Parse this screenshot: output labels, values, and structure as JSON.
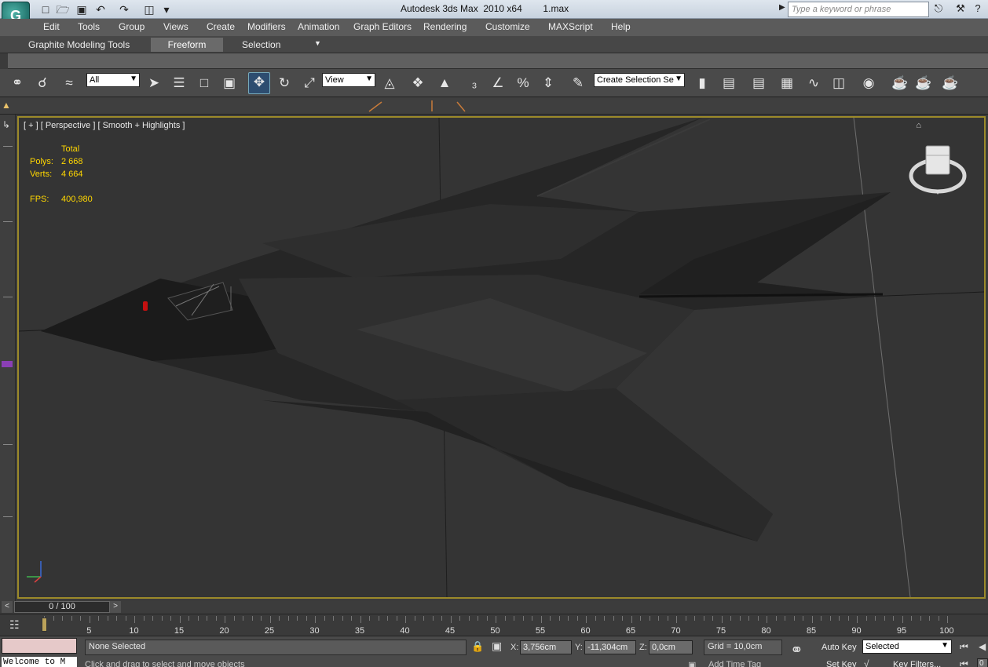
{
  "title_bar": {
    "title": "Autodesk 3ds Max  2010 x64        1.max",
    "search_placeholder": "Type a keyword or phrase",
    "logo_glyph": "G"
  },
  "menu": [
    "Edit",
    "Tools",
    "Group",
    "Views",
    "Create",
    "Modifiers",
    "Animation",
    "Graph Editors",
    "Rendering",
    "Customize",
    "MAXScript",
    "Help"
  ],
  "ribbon": {
    "tabs": [
      "Graphite Modeling Tools",
      "Freeform",
      "Selection"
    ],
    "active_tab": "Freeform"
  },
  "toolbar": {
    "filter_value": "All",
    "coord_value": "View",
    "selection_set_placeholder": "Create Selection Se"
  },
  "viewport": {
    "label": "[ + ] [ Perspective ] [ Smooth + Highlights ]",
    "stats": {
      "header": "Total",
      "polys_label": "Polys:",
      "polys_value": "2 668",
      "verts_label": "Verts:",
      "verts_value": "4 664",
      "fps_label": "FPS:",
      "fps_value": "400,980"
    }
  },
  "timeline": {
    "frame_display": "0 / 100",
    "prev_arrow": "<",
    "next_arrow": ">",
    "ticks": [
      "5",
      "10",
      "15",
      "20",
      "25",
      "30",
      "35",
      "40",
      "45",
      "50",
      "55",
      "60",
      "65",
      "70",
      "75",
      "80",
      "85",
      "90",
      "95",
      "100"
    ],
    "current_frame": 0,
    "frame_count": 100
  },
  "status": {
    "listener_output": "Welcome to M",
    "selection_info": "None Selected",
    "prompt": "Click and drag to select and move objects",
    "x_label": "X:",
    "x_value": "3,756cm",
    "y_label": "Y:",
    "y_value": "-11,304cm",
    "z_label": "Z:",
    "z_value": "0,0cm",
    "grid": "Grid = 10,0cm",
    "add_time_tag": "Add Time Tag",
    "auto_key": "Auto Key",
    "set_key": "Set Key",
    "auto_key_mode": "Selected",
    "key_filters": "Key Filters...",
    "frame_field": "0"
  },
  "accent_colors": {
    "viewport_border": "#9c8a2a",
    "stats_text": "#ffd700",
    "move_active": "#2d4d70"
  }
}
